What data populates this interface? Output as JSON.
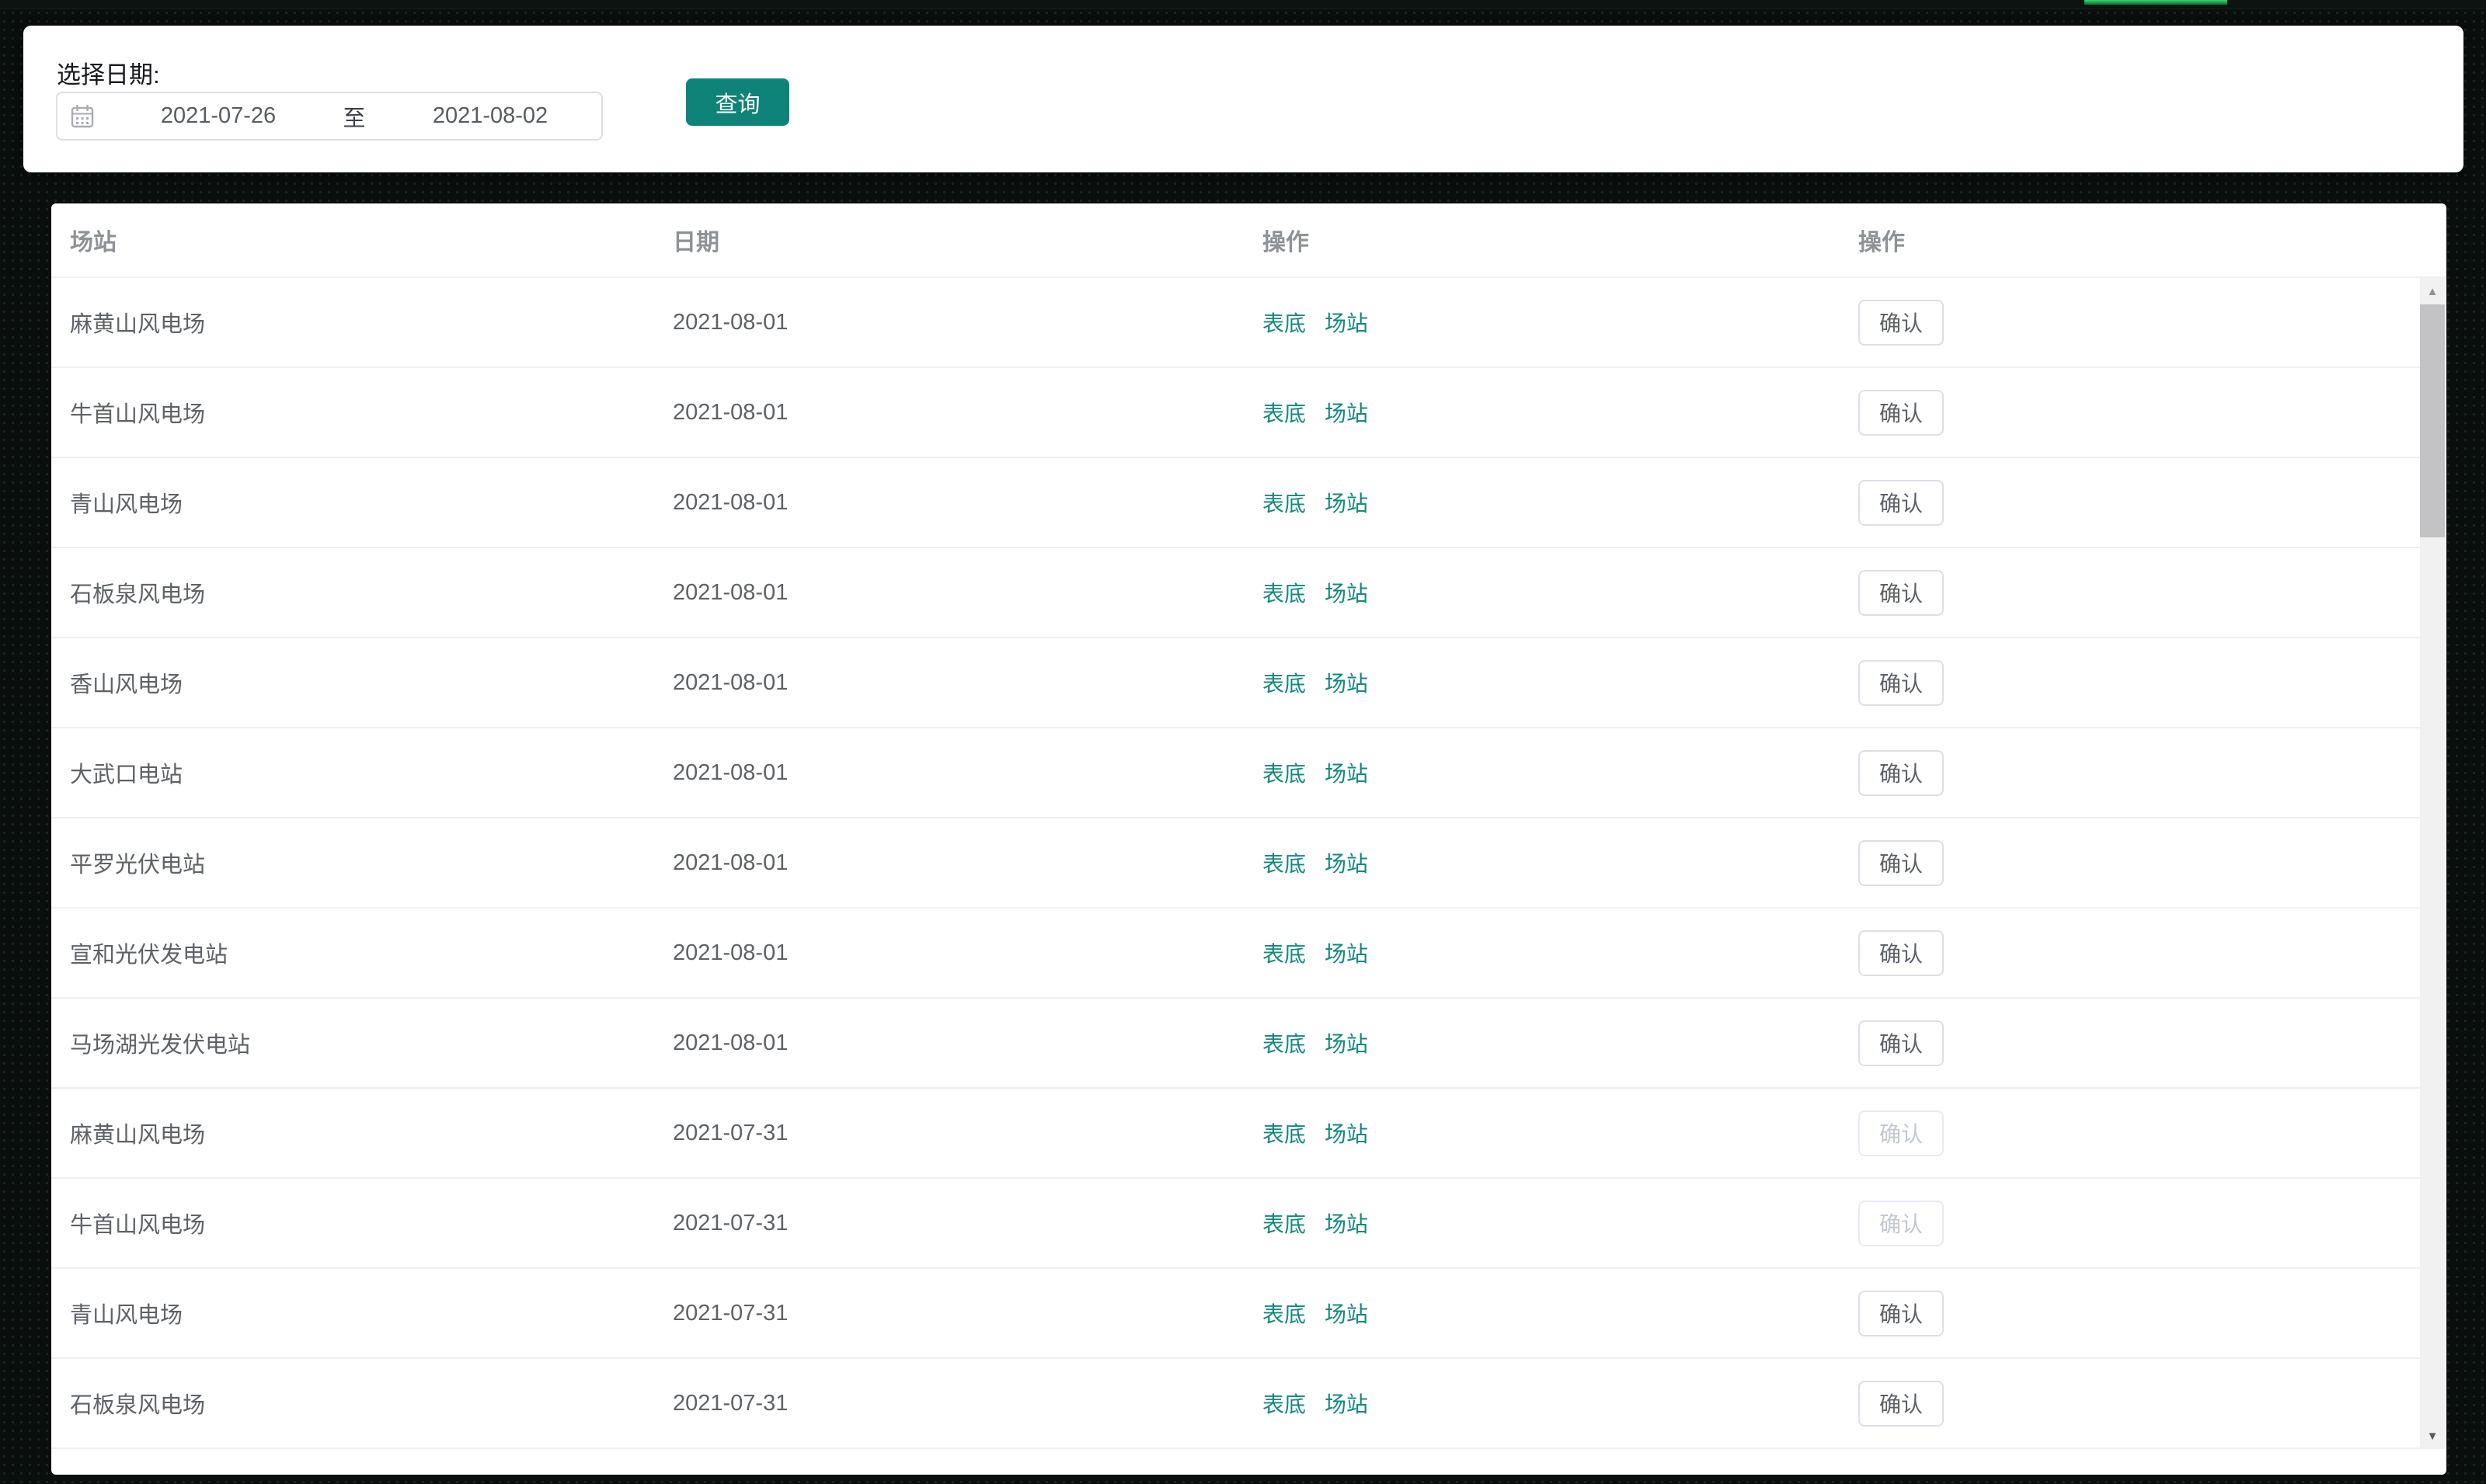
{
  "window": {
    "top_bar": {
      "has_green_fragment": true
    }
  },
  "filter_panel": {
    "date_label": "选择日期:",
    "date_picker": {
      "start_value": "2021-07-26",
      "separator": "至",
      "end_value": "2021-08-02"
    },
    "query_button_label": "查询"
  },
  "table": {
    "headers": [
      "场站",
      "日期",
      "操作",
      "操作"
    ],
    "row_action_links": [
      "表底",
      "场站"
    ],
    "confirm_button_label": "确认",
    "rows": [
      {
        "station": "麻黄山风电场",
        "date": "2021-08-01",
        "confirm_enabled": true
      },
      {
        "station": "牛首山风电场",
        "date": "2021-08-01",
        "confirm_enabled": true
      },
      {
        "station": "青山风电场",
        "date": "2021-08-01",
        "confirm_enabled": true
      },
      {
        "station": "石板泉风电场",
        "date": "2021-08-01",
        "confirm_enabled": true
      },
      {
        "station": "香山风电场",
        "date": "2021-08-01",
        "confirm_enabled": true
      },
      {
        "station": "大武口电站",
        "date": "2021-08-01",
        "confirm_enabled": true
      },
      {
        "station": "平罗光伏电站",
        "date": "2021-08-01",
        "confirm_enabled": true
      },
      {
        "station": "宣和光伏发电站",
        "date": "2021-08-01",
        "confirm_enabled": true
      },
      {
        "station": "马场湖光发伏电站",
        "date": "2021-08-01",
        "confirm_enabled": true
      },
      {
        "station": "麻黄山风电场",
        "date": "2021-07-31",
        "confirm_enabled": false
      },
      {
        "station": "牛首山风电场",
        "date": "2021-07-31",
        "confirm_enabled": false
      },
      {
        "station": "青山风电场",
        "date": "2021-07-31",
        "confirm_enabled": true
      },
      {
        "station": "石板泉风电场",
        "date": "2021-07-31",
        "confirm_enabled": true
      }
    ]
  },
  "icons": {
    "calendar_icon": "calendar",
    "scroll_up_icon": "▲",
    "scroll_down_icon": "▼"
  },
  "colors": {
    "accent_teal": "#0d8477",
    "link_teal": "#13897c",
    "green_bar": "#2bc563",
    "header_text": "#8e9297",
    "body_text": "#5e6267",
    "disabled_text": "#c3c7cf"
  }
}
